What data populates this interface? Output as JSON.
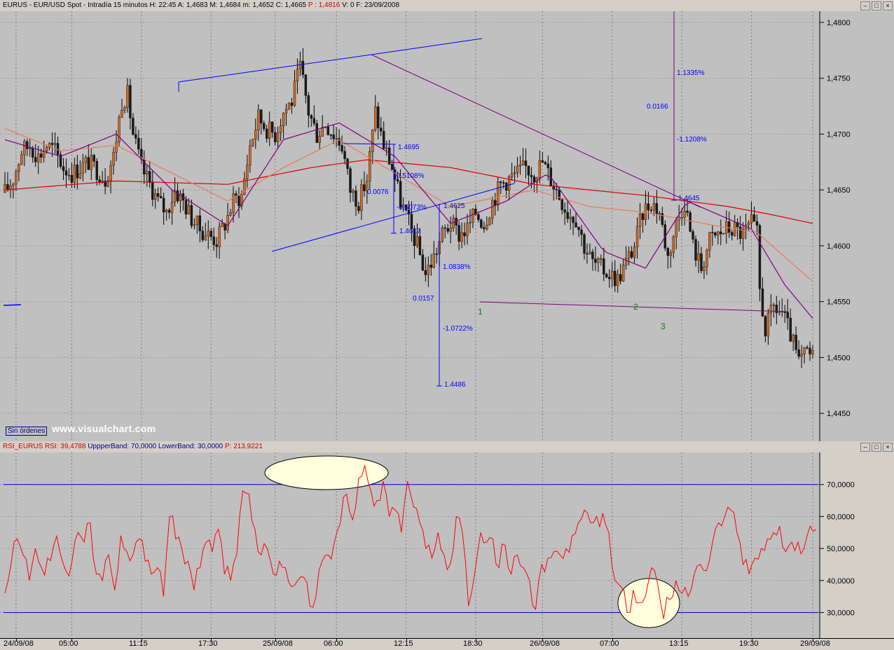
{
  "price_header": {
    "symbol": "EURUS",
    "description": "EURUS - EUR/USD Spot - Intradía 15 minutos",
    "h_label": "H:",
    "h": "22:45",
    "a_label": "A:",
    "a": "1,4683",
    "m_label": "M:",
    "m": "1,4684",
    "min_label": "m:",
    "min": "1,4652",
    "c_label": "C:",
    "c": "1,4665",
    "p_label": "P :",
    "p": "1,4816",
    "v_label": "V:",
    "v": "0",
    "f_label": "F:",
    "f": "23/09/2008"
  },
  "rsi_header": {
    "name": "RSI_EURUS",
    "rsi_label": "RSI:",
    "rsi": "39,4788",
    "upper_label": "UppperBand:",
    "upper": "70,0000",
    "lower_label": "LowerBand:",
    "lower": "30,0000",
    "p_label": "P:",
    "p": "213,9221"
  },
  "window_buttons": [
    "–",
    "□",
    "×"
  ],
  "orders_badge": "Sin órdenes",
  "watermark": "www.visualchart.com",
  "colors": {
    "background": "#c0c0c0",
    "candle_up": "#d2691e",
    "candle_down": "#1a1a1a",
    "ma_long": "#dd0000",
    "ma_mid": "#e87a5a",
    "ma_short": "#800080",
    "annotation": "#0000ff",
    "trendline": "#800080",
    "rsi_line": "#ff0000",
    "band": "#0000cc",
    "highlight": "#ffffdd",
    "wave_label": "#008000"
  },
  "chart_data": [
    {
      "type": "candlestick",
      "title": "EURUS - EUR/USD Spot - Intradía 15 minutos",
      "x_ticks": [
        "24/09/08",
        "05:00",
        "11:15",
        "17:30",
        "25/09/08",
        "06:00",
        "12:15",
        "18:30",
        "26/09/08",
        "07:00",
        "13:15",
        "19:30",
        "29/09/08"
      ],
      "y_ticks": [
        "1,4800",
        "1,4750",
        "1,4700",
        "1,4650",
        "1,4600",
        "1,4550",
        "1,4500",
        "1,4450"
      ],
      "ylim": [
        1.4425,
        1.481
      ],
      "close_path": [
        [
          0,
          1.4648
        ],
        [
          3,
          1.466
        ],
        [
          6,
          1.4685
        ],
        [
          9,
          1.469
        ],
        [
          12,
          1.468
        ],
        [
          15,
          1.469
        ],
        [
          18,
          1.4685
        ],
        [
          21,
          1.467
        ],
        [
          24,
          1.4665
        ],
        [
          27,
          1.467
        ],
        [
          30,
          1.4675
        ],
        [
          33,
          1.4668
        ],
        [
          36,
          1.466
        ],
        [
          39,
          1.468
        ],
        [
          42,
          1.473
        ],
        [
          44,
          1.4735
        ],
        [
          46,
          1.47
        ],
        [
          49,
          1.467
        ],
        [
          52,
          1.4655
        ],
        [
          55,
          1.464
        ],
        [
          58,
          1.463
        ],
        [
          61,
          1.465
        ],
        [
          64,
          1.464
        ],
        [
          67,
          1.4625
        ],
        [
          70,
          1.4615
        ],
        [
          73,
          1.461
        ],
        [
          76,
          1.4605
        ],
        [
          79,
          1.462
        ],
        [
          82,
          1.464
        ],
        [
          85,
          1.4645
        ],
        [
          88,
          1.469
        ],
        [
          91,
          1.4715
        ],
        [
          94,
          1.4705
        ],
        [
          97,
          1.47
        ],
        [
          100,
          1.472
        ],
        [
          103,
          1.473
        ],
        [
          106,
          1.476
        ],
        [
          109,
          1.472
        ],
        [
          112,
          1.47
        ],
        [
          115,
          1.471
        ],
        [
          118,
          1.47
        ],
        [
          121,
          1.469
        ],
        [
          124,
          1.465
        ],
        [
          127,
          1.464
        ],
        [
          130,
          1.466
        ],
        [
          133,
          1.472
        ],
        [
          136,
          1.469
        ],
        [
          139,
          1.467
        ],
        [
          142,
          1.464
        ],
        [
          145,
          1.462
        ],
        [
          148,
          1.46
        ],
        [
          151,
          1.4575
        ],
        [
          154,
          1.459
        ],
        [
          157,
          1.461
        ],
        [
          160,
          1.462
        ],
        [
          163,
          1.461
        ],
        [
          166,
          1.4615
        ],
        [
          169,
          1.463
        ],
        [
          172,
          1.462
        ],
        [
          175,
          1.464
        ],
        [
          178,
          1.4655
        ],
        [
          181,
          1.466
        ],
        [
          184,
          1.4665
        ],
        [
          187,
          1.467
        ],
        [
          190,
          1.4665
        ],
        [
          193,
          1.4675
        ],
        [
          196,
          1.466
        ],
        [
          199,
          1.4645
        ],
        [
          202,
          1.463
        ],
        [
          205,
          1.4625
        ],
        [
          208,
          1.46
        ],
        [
          211,
          1.4585
        ],
        [
          214,
          1.458
        ],
        [
          217,
          1.4575
        ],
        [
          220,
          1.457
        ],
        [
          223,
          1.4585
        ],
        [
          226,
          1.46
        ],
        [
          229,
          1.463
        ],
        [
          232,
          1.464
        ],
        [
          235,
          1.463
        ],
        [
          238,
          1.459
        ],
        [
          241,
          1.462
        ],
        [
          244,
          1.464
        ],
        [
          247,
          1.46
        ],
        [
          250,
          1.458
        ],
        [
          253,
          1.4605
        ],
        [
          256,
          1.461
        ],
        [
          259,
          1.4615
        ],
        [
          262,
          1.4615
        ],
        [
          265,
          1.461
        ],
        [
          268,
          1.462
        ],
        [
          270,
          1.461
        ],
        [
          271,
          1.456
        ],
        [
          273,
          1.4525
        ],
        [
          276,
          1.4545
        ],
        [
          279,
          1.454
        ],
        [
          282,
          1.452
        ],
        [
          285,
          1.4495
        ],
        [
          288,
          1.4505
        ],
        [
          290,
          1.45
        ]
      ],
      "ma_long": [
        [
          0,
          1.465
        ],
        [
          40,
          1.4658
        ],
        [
          80,
          1.4655
        ],
        [
          110,
          1.467
        ],
        [
          130,
          1.4677
        ],
        [
          160,
          1.467
        ],
        [
          190,
          1.4655
        ],
        [
          230,
          1.4645
        ],
        [
          260,
          1.4635
        ],
        [
          275,
          1.4628
        ],
        [
          290,
          1.462
        ]
      ],
      "ma_mid": [
        [
          0,
          1.4705
        ],
        [
          20,
          1.4685
        ],
        [
          40,
          1.469
        ],
        [
          60,
          1.4665
        ],
        [
          80,
          1.464
        ],
        [
          100,
          1.467
        ],
        [
          120,
          1.4695
        ],
        [
          140,
          1.4665
        ],
        [
          160,
          1.4635
        ],
        [
          190,
          1.465
        ],
        [
          210,
          1.4635
        ],
        [
          230,
          1.463
        ],
        [
          255,
          1.4618
        ],
        [
          270,
          1.4612
        ],
        [
          290,
          1.4568
        ]
      ],
      "ma_short": [
        [
          0,
          1.4695
        ],
        [
          20,
          1.468
        ],
        [
          40,
          1.47
        ],
        [
          60,
          1.465
        ],
        [
          80,
          1.4618
        ],
        [
          100,
          1.4695
        ],
        [
          120,
          1.471
        ],
        [
          140,
          1.468
        ],
        [
          160,
          1.462
        ],
        [
          180,
          1.464
        ],
        [
          195,
          1.4665
        ],
        [
          215,
          1.4595
        ],
        [
          230,
          1.458
        ],
        [
          245,
          1.464
        ],
        [
          268,
          1.4615
        ],
        [
          280,
          1.4565
        ],
        [
          290,
          1.4535
        ]
      ],
      "annotations": [
        "1.4695",
        "0.5108%",
        "0.0076",
        "-0.5073%",
        "1.4617",
        "1.4625",
        "1.0838%",
        "0.0157",
        "-1.0722%",
        "1.4486",
        "1.1335%",
        "0.0166",
        "-1.1208%",
        "1.4645"
      ],
      "wave_labels": [
        "1",
        "2",
        "3"
      ]
    },
    {
      "type": "line",
      "title": "RSI_EURUS",
      "series": [
        {
          "name": "RSI",
          "values": [
            36,
            45,
            53,
            48,
            40,
            50,
            44,
            47,
            51,
            49,
            43,
            46,
            55,
            52,
            58,
            42,
            40,
            48,
            37,
            54,
            49,
            48,
            53,
            46,
            42,
            44,
            35,
            60,
            53,
            50,
            46,
            37,
            44,
            52,
            49,
            56,
            42,
            40,
            48,
            68,
            67,
            56,
            48,
            50,
            42,
            46,
            44,
            38,
            40,
            41,
            32,
            35,
            46,
            48,
            52,
            58,
            67,
            59,
            72,
            76,
            68,
            65,
            71,
            60,
            62,
            55,
            71,
            63,
            58,
            50,
            47,
            55,
            48,
            45,
            60,
            55,
            32,
            42,
            55,
            52,
            53,
            44,
            51,
            42,
            48,
            44,
            40,
            31,
            45,
            47,
            49,
            48,
            50,
            54,
            58,
            62,
            58,
            60,
            61,
            55,
            40,
            38,
            30,
            37,
            33,
            35,
            44,
            39,
            28,
            34,
            40,
            36,
            35,
            42,
            45,
            43,
            52,
            58,
            60,
            62,
            55,
            45,
            42,
            47,
            50,
            53,
            55,
            57,
            49,
            52,
            52,
            50,
            57,
            56
          ]
        }
      ],
      "y_ticks": [
        "70,0000",
        "60,0000",
        "50,0000",
        "40,0000",
        "30,0000"
      ],
      "ylim": [
        22,
        80
      ],
      "bands": [
        70,
        30
      ]
    }
  ]
}
